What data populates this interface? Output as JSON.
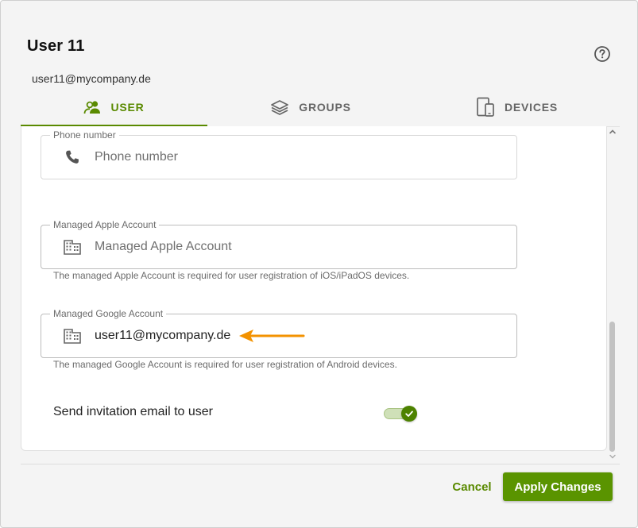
{
  "dialog": {
    "title": "User 11",
    "subtitle": "user11@mycompany.de"
  },
  "tabs": [
    {
      "label": "USER",
      "icon": "users-icon",
      "active": true
    },
    {
      "label": "GROUPS",
      "icon": "layers-icon",
      "active": false
    },
    {
      "label": "DEVICES",
      "icon": "devices-icon",
      "active": false
    }
  ],
  "form": {
    "phone": {
      "label": "Phone number",
      "placeholder": "Phone number",
      "value": "",
      "icon": "phone-icon"
    },
    "apple": {
      "label": "Managed Apple Account",
      "placeholder": "Managed Apple Account",
      "value": "",
      "icon": "building-icon",
      "help": "The managed Apple Account is required for user registration of iOS/iPadOS devices."
    },
    "google": {
      "label": "Managed Google Account",
      "placeholder": "",
      "value": "user11@mycompany.de",
      "icon": "building-icon",
      "help": "The managed Google Account is required for user registration of Android devices."
    },
    "invite": {
      "label": "Send invitation email to user",
      "enabled": true
    }
  },
  "footer": {
    "cancel_label": "Cancel",
    "apply_label": "Apply Changes"
  },
  "colors": {
    "accent": "#5a8a00",
    "apply_button": "#5a9400",
    "arrow": "#f39200"
  }
}
